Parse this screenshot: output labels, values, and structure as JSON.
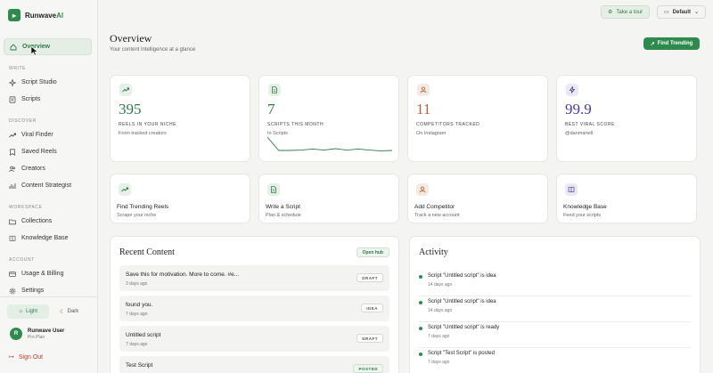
{
  "brand": {
    "name": "Runwave",
    "suffix": "AI"
  },
  "sidebar": {
    "items": [
      {
        "label": "Overview",
        "icon": "home-icon",
        "active": true
      },
      {
        "section": "WRITE"
      },
      {
        "label": "Script Studio",
        "icon": "sparkle-icon"
      },
      {
        "label": "Scripts",
        "icon": "scripts-icon"
      },
      {
        "section": "DISCOVER"
      },
      {
        "label": "Viral Finder",
        "icon": "trending-icon"
      },
      {
        "label": "Saved Reels",
        "icon": "bookmark-icon"
      },
      {
        "label": "Creators",
        "icon": "people-icon"
      },
      {
        "label": "Content Strategist",
        "icon": "chart-icon"
      },
      {
        "section": "WORKSPACE"
      },
      {
        "label": "Collections",
        "icon": "folder-icon"
      },
      {
        "label": "Knowledge Base",
        "icon": "book-icon"
      },
      {
        "section": "ACCOUNT"
      },
      {
        "label": "Usage & Billing",
        "icon": "card-icon"
      },
      {
        "label": "Settings",
        "icon": "gear-icon"
      }
    ],
    "theme": {
      "light": "Light",
      "dark": "Dark"
    },
    "user": {
      "initial": "R",
      "name": "Runwave User",
      "plan": "Pro Plan"
    },
    "signout": "Sign Out"
  },
  "topbar": {
    "tour": "Take a tour",
    "workspace": "Default"
  },
  "header": {
    "title": "Overview",
    "subtitle": "Your content intelligence at a glance",
    "cta": "Find Trending"
  },
  "stats": [
    {
      "value": "395",
      "label": "REELS IN YOUR NICHE",
      "sub": "From tracked creators",
      "color": "#2f7a46",
      "bg": "#e6f0e7",
      "icon": "trending-icon"
    },
    {
      "value": "7",
      "label": "SCRIPTS THIS MONTH",
      "sub": "In Scripts",
      "color": "#2f7a46",
      "bg": "#e6f0e7",
      "icon": "document-icon"
    },
    {
      "value": "11",
      "label": "COMPETITORS TRACKED",
      "sub": "On Instagram",
      "color": "#b5623a",
      "bg": "#f6e9e2",
      "icon": "person-icon"
    },
    {
      "value": "99.9",
      "label": "BEST VIRAL SCORE",
      "sub": "@danmartell",
      "color": "#4a3d9a",
      "bg": "#ebe8f6",
      "icon": "bolt-icon"
    }
  ],
  "sparkline": [
    0.95,
    0.2,
    0.2,
    0.22,
    0.28,
    0.22,
    0.3,
    0.22,
    0.28,
    0.22,
    0.18,
    0.2
  ],
  "actions": [
    {
      "title": "Find Trending Reels",
      "sub": "Scrape your niche",
      "color": "#2f7a46",
      "bg": "#e6f0e7",
      "icon": "trending-icon"
    },
    {
      "title": "Write a Script",
      "sub": "Plan & schedule",
      "color": "#2f7a46",
      "bg": "#e6f0e7",
      "icon": "document-icon"
    },
    {
      "title": "Add Competitor",
      "sub": "Track a new account",
      "color": "#b5623a",
      "bg": "#f6e9e2",
      "icon": "person-icon"
    },
    {
      "title": "Knowledge Base",
      "sub": "Feed your scripts",
      "color": "#4a3d9a",
      "bg": "#ebe8f6",
      "icon": "book-icon"
    }
  ],
  "recent": {
    "title": "Recent Content",
    "button": "Open hub",
    "items": [
      {
        "title": "Save this for motivation. More to come. #e...",
        "time": "3 days ago",
        "badge": "DRAFT"
      },
      {
        "title": "found you.",
        "time": "7 days ago",
        "badge": "IDEA"
      },
      {
        "title": "Untitled script",
        "time": "7 days ago",
        "badge": "DRAFT"
      },
      {
        "title": "Test Script",
        "time": "",
        "badge": "POSTED"
      }
    ]
  },
  "activity": {
    "title": "Activity",
    "items": [
      {
        "text": "Script \"Untitled script\" is idea",
        "time": "14 days ago"
      },
      {
        "text": "Script \"Untitled script\" is idea",
        "time": "14 days ago"
      },
      {
        "text": "Script \"Untitled script\" is ready",
        "time": "7 days ago"
      },
      {
        "text": "Script \"Test Script\" is posted",
        "time": "7 days ago"
      }
    ]
  }
}
